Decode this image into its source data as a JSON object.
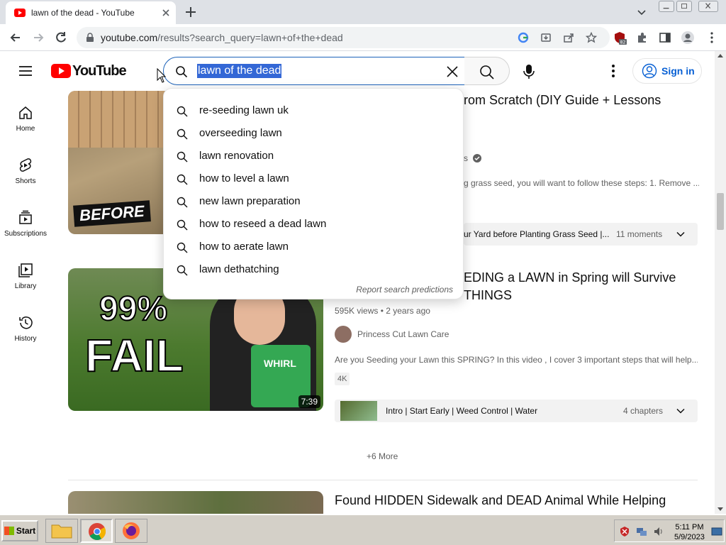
{
  "browser": {
    "tab_title": "lawn of the dead - YouTube",
    "url_host": "youtube.com",
    "url_path": "/results?search_query=lawn+of+the+dead",
    "extension_badge": "82"
  },
  "youtube": {
    "logo_text": "YouTube",
    "search_query": "lawn of the dead",
    "signin_label": "Sign in"
  },
  "guide": [
    {
      "label": "Home",
      "icon": "home-icon"
    },
    {
      "label": "Shorts",
      "icon": "shorts-icon"
    },
    {
      "label": "Subscriptions",
      "icon": "subscriptions-icon"
    },
    {
      "label": "Library",
      "icon": "library-icon"
    },
    {
      "label": "History",
      "icon": "history-icon"
    }
  ],
  "suggestions": [
    "re-seeding lawn uk",
    "overseeding lawn",
    "lawn renovation",
    "how to level a lawn",
    "new lawn preparation",
    "how to reseed a dead lawn",
    "how to aerate lawn",
    "lawn dethatching"
  ],
  "report_predictions": "Report search predictions",
  "videos": [
    {
      "thumb_badge": "BEFORE",
      "title_visible": "rom Scratch (DIY Guide + Lessons",
      "channel_suffix": "s",
      "desc_visible": "g grass seed, you will want to follow these steps: 1. Remove ...",
      "chapter_text": "ur Yard before Planting Grass Seed |...",
      "chapter_count": "11 moments"
    },
    {
      "thumb_text_1": "99%",
      "thumb_text_2": "FAIL",
      "bucket_label": "WHIRL",
      "duration": "7:39",
      "title_line1": "EDING a LAWN in Spring will Survive",
      "title_line2": "THINGS",
      "meta": "595K views • 2 years ago",
      "channel": "Princess Cut Lawn Care",
      "desc": "Are you Seeding your Lawn this SPRING? In this video , I cover 3 important steps that will help...",
      "badge": "4K",
      "chapter_text": "Intro | Start Early | Weed Control | Water",
      "chapter_count": "4 chapters"
    },
    {
      "title": "Found HIDDEN Sidewalk and DEAD Animal While Helping"
    }
  ],
  "more_link": "+6 More",
  "taskbar": {
    "start_label": "Start",
    "time": "5:11 PM",
    "date": "5/9/2023"
  },
  "colors": {
    "youtube_red": "#ff0000",
    "link_blue": "#065fd4",
    "selection_blue": "#3367d6"
  }
}
